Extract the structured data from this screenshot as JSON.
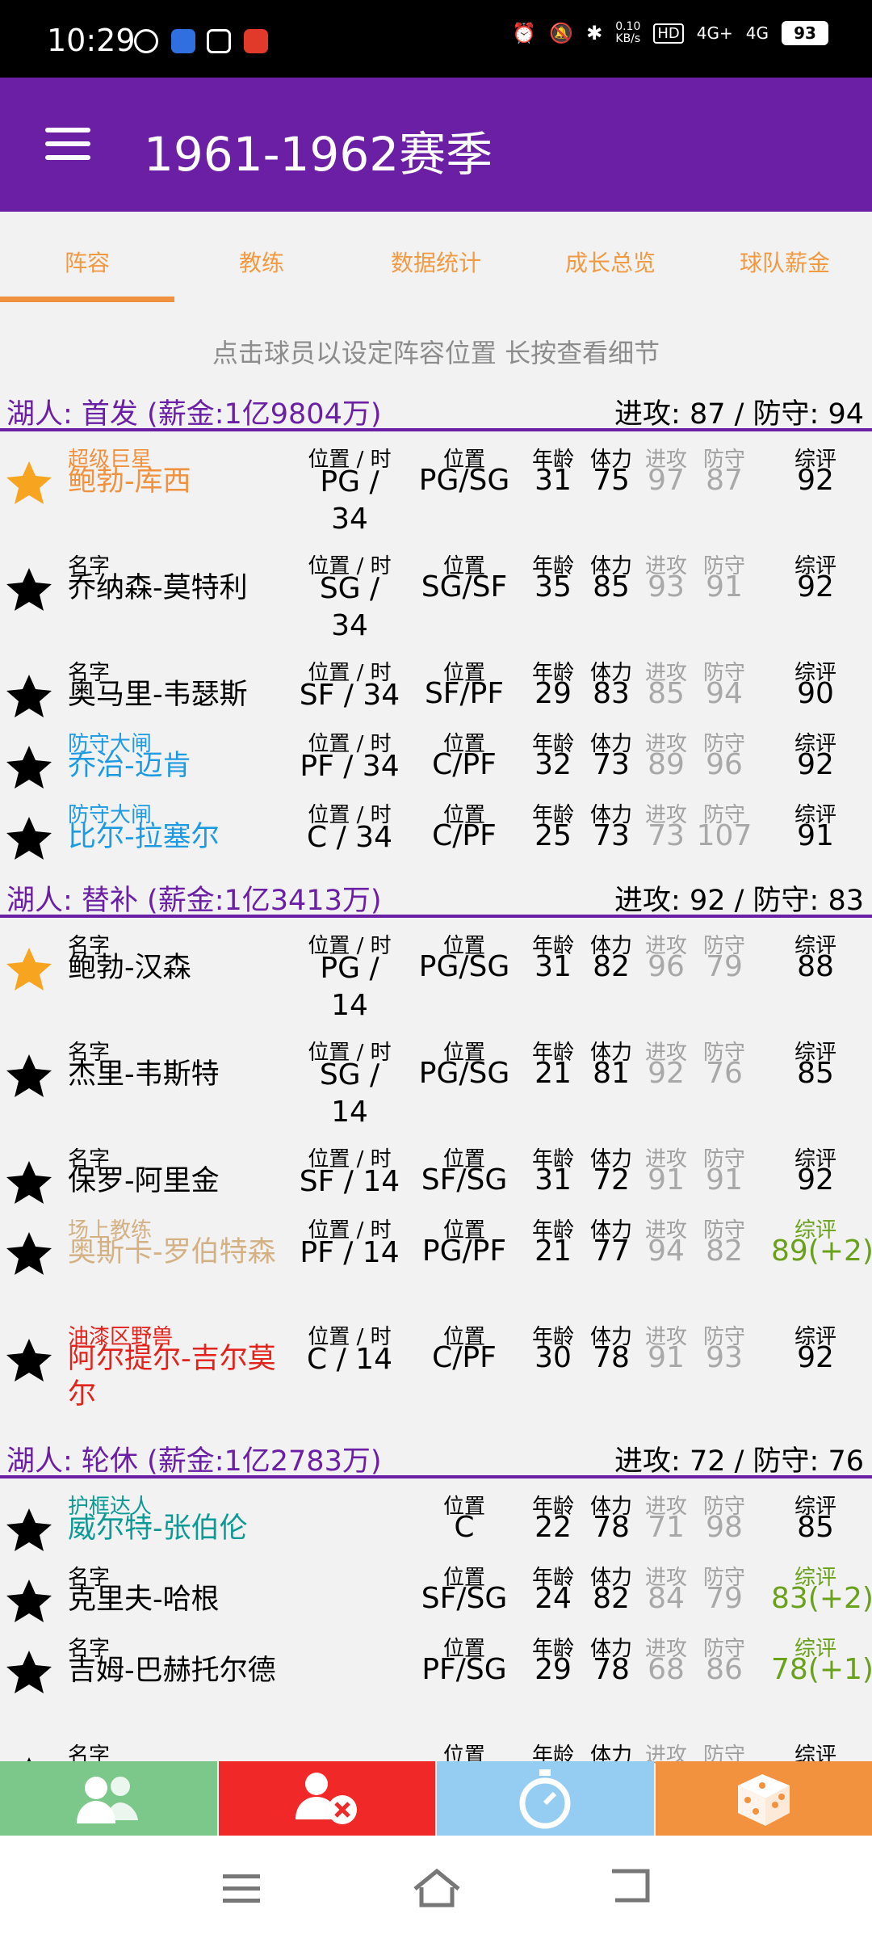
{
  "status_bar": {
    "time": "10:29",
    "net_speed_top": "0.10",
    "net_speed_bottom": "KB/s",
    "signal1": "4G+",
    "signal2": "4G",
    "battery": "93"
  },
  "app_bar": {
    "title": "1961-1962赛季"
  },
  "tabs": [
    {
      "label": "阵容",
      "active": true
    },
    {
      "label": "教练"
    },
    {
      "label": "数据统计"
    },
    {
      "label": "成长总览"
    },
    {
      "label": "球队薪金"
    }
  ],
  "hint": "点击球员以设定阵容位置 长按查看细节",
  "col_headers": {
    "pos_time": "位置 / 时",
    "pos": "位置",
    "age": "年龄",
    "stamina": "体力",
    "off": "进攻",
    "def": "防守",
    "overall": "综评"
  },
  "sections": [
    {
      "label": "湖人: 首发 (薪金:1亿9804万)",
      "rating": "进攻: 87  /  防守: 94"
    },
    {
      "label": "湖人: 替补 (薪金:1亿3413万)",
      "rating": "进攻: 92  /  防守: 83"
    },
    {
      "label": "湖人: 轮休 (薪金:1亿2783万)",
      "rating": "进攻: 72  /  防守: 76"
    }
  ],
  "starters": [
    {
      "tag": "超级巨星",
      "name": "鲍勃-库西",
      "pt": "PG /",
      "pt2": "34",
      "pos": "PG/SG",
      "age": "31",
      "stamina": "75",
      "off": "97",
      "def": "87",
      "overall": "92"
    },
    {
      "tag": "名字",
      "name": "乔纳森-莫特利",
      "pt": "SG /",
      "pt2": "34",
      "pos": "SG/SF",
      "age": "35",
      "stamina": "85",
      "off": "93",
      "def": "91",
      "overall": "92"
    },
    {
      "tag": "名字",
      "name": "奥马里-韦瑟斯",
      "pt": "SF / 34",
      "pos": "SF/PF",
      "age": "29",
      "stamina": "83",
      "off": "85",
      "def": "94",
      "overall": "90"
    },
    {
      "tag": "防守大闸",
      "name": "乔治-迈肯",
      "pt": "PF / 34",
      "pos": "C/PF",
      "age": "32",
      "stamina": "73",
      "off": "89",
      "def": "96",
      "overall": "92"
    },
    {
      "tag": "防守大闸",
      "name": "比尔-拉塞尔",
      "pt": "C / 34",
      "pos": "C/PF",
      "age": "25",
      "stamina": "73",
      "off": "73",
      "def": "107",
      "overall": "91"
    }
  ],
  "bench": [
    {
      "tag": "名字",
      "name": "鲍勃-汉森",
      "pt": "PG /",
      "pt2": "14",
      "pos": "PG/SG",
      "age": "31",
      "stamina": "82",
      "off": "96",
      "def": "79",
      "overall": "88"
    },
    {
      "tag": "名字",
      "name": "杰里-韦斯特",
      "pt": "SG /",
      "pt2": "14",
      "pos": "PG/SG",
      "age": "21",
      "stamina": "81",
      "off": "92",
      "def": "76",
      "overall": "85"
    },
    {
      "tag": "名字",
      "name": "保罗-阿里金",
      "pt": "SF / 14",
      "pos": "SF/SG",
      "age": "31",
      "stamina": "72",
      "off": "91",
      "def": "91",
      "overall": "92"
    },
    {
      "tag": "场上教练",
      "name": "奥斯卡-罗伯特森",
      "pt": "PF / 14",
      "pos": "PG/PF",
      "age": "21",
      "stamina": "77",
      "off": "94",
      "def": "82",
      "overall": "89(+2)"
    },
    {
      "tag": "油漆区野兽",
      "name": "阿尔提尔-吉尔莫尔",
      "pt": "C / 14",
      "pos": "C/PF",
      "age": "30",
      "stamina": "78",
      "off": "91",
      "def": "93",
      "overall": "92"
    }
  ],
  "rest": [
    {
      "tag": "护框达人",
      "name": "威尔特-张伯伦",
      "pos": "C",
      "age": "22",
      "stamina": "78",
      "off": "71",
      "def": "98",
      "overall": "85"
    },
    {
      "tag": "名字",
      "name": "克里夫-哈根",
      "pos": "SF/SG",
      "age": "24",
      "stamina": "82",
      "off": "84",
      "def": "79",
      "overall": "83(+2)"
    },
    {
      "tag": "名字",
      "name": "吉姆-巴赫托尔德",
      "pos": "PF/SG",
      "age": "29",
      "stamina": "78",
      "off": "68",
      "def": "86",
      "overall": "78(+1)"
    },
    {
      "tag": "名字"
    }
  ],
  "colors": {
    "purple": "#6a1fa5",
    "orange": "#f0913f",
    "gold_star": "#f7a520",
    "blue": "#1e9be0",
    "tan": "#d3b184",
    "red": "#e3221b",
    "teal": "#0c9a96",
    "green": "#6aa11a"
  }
}
